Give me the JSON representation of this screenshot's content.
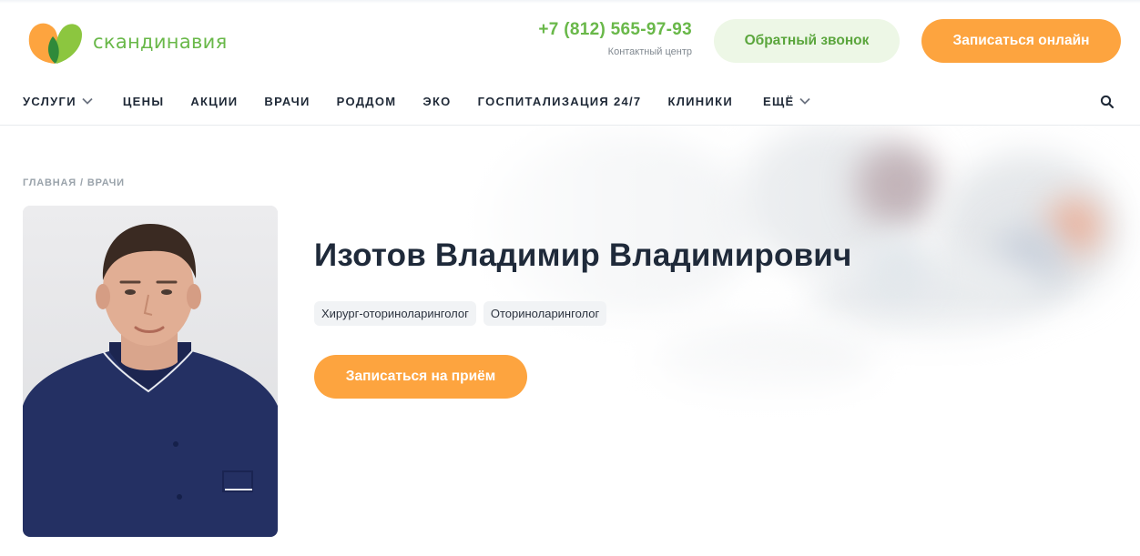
{
  "header": {
    "logo_text": "скандинавия",
    "phone": "+7 (812) 565-97-93",
    "phone_caption": "Контактный центр",
    "callback_label": "Обратный звонок",
    "online_label": "Записаться онлайн"
  },
  "nav": {
    "items": [
      {
        "label": "Услуги",
        "has_dropdown": true
      },
      {
        "label": "Цены",
        "has_dropdown": false
      },
      {
        "label": "Акции",
        "has_dropdown": false
      },
      {
        "label": "Врачи",
        "has_dropdown": false
      },
      {
        "label": "Роддом",
        "has_dropdown": false
      },
      {
        "label": "ЭКО",
        "has_dropdown": false
      },
      {
        "label": "Госпитализация 24/7",
        "has_dropdown": false
      },
      {
        "label": "Клиники",
        "has_dropdown": false
      },
      {
        "label": "Ещё",
        "has_dropdown": true
      }
    ],
    "search_icon": "search-icon"
  },
  "breadcrumb": {
    "items": [
      "Главная",
      "Врачи"
    ],
    "separator": "/"
  },
  "doctor": {
    "name": "Изотов Владимир Владимирович",
    "specialties": [
      "Хирург-оториноларинголог",
      "Оториноларинголог"
    ],
    "appointment_label": "Записаться на приём"
  },
  "colors": {
    "brand_green": "#69b849",
    "accent_orange": "#fda43f",
    "callback_bg": "#edf7e6",
    "text_dark": "#1f2a3a"
  }
}
